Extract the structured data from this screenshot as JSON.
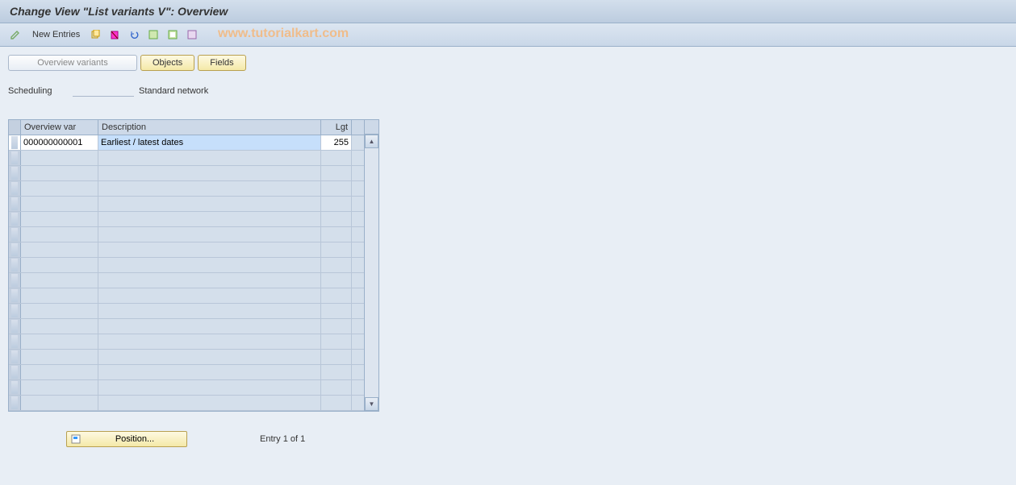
{
  "title": "Change View \"List variants                    V\": Overview",
  "toolbar": {
    "new_entries": "New Entries",
    "watermark": "www.tutorialkart.com"
  },
  "tabs": {
    "overview_variants": "Overview variants",
    "objects": "Objects",
    "fields": "Fields"
  },
  "fields": {
    "scheduling_label": "Scheduling",
    "scheduling_value": "Standard network"
  },
  "table": {
    "headers": {
      "overview_var": "Overview var",
      "description": "Description",
      "lgt": "Lgt"
    },
    "rows": [
      {
        "overview_var": "000000000001",
        "description": "Earliest / latest dates",
        "lgt": "255"
      }
    ],
    "empty_rows": 17
  },
  "footer": {
    "position_label": "Position...",
    "entry_text": "Entry 1 of 1"
  }
}
